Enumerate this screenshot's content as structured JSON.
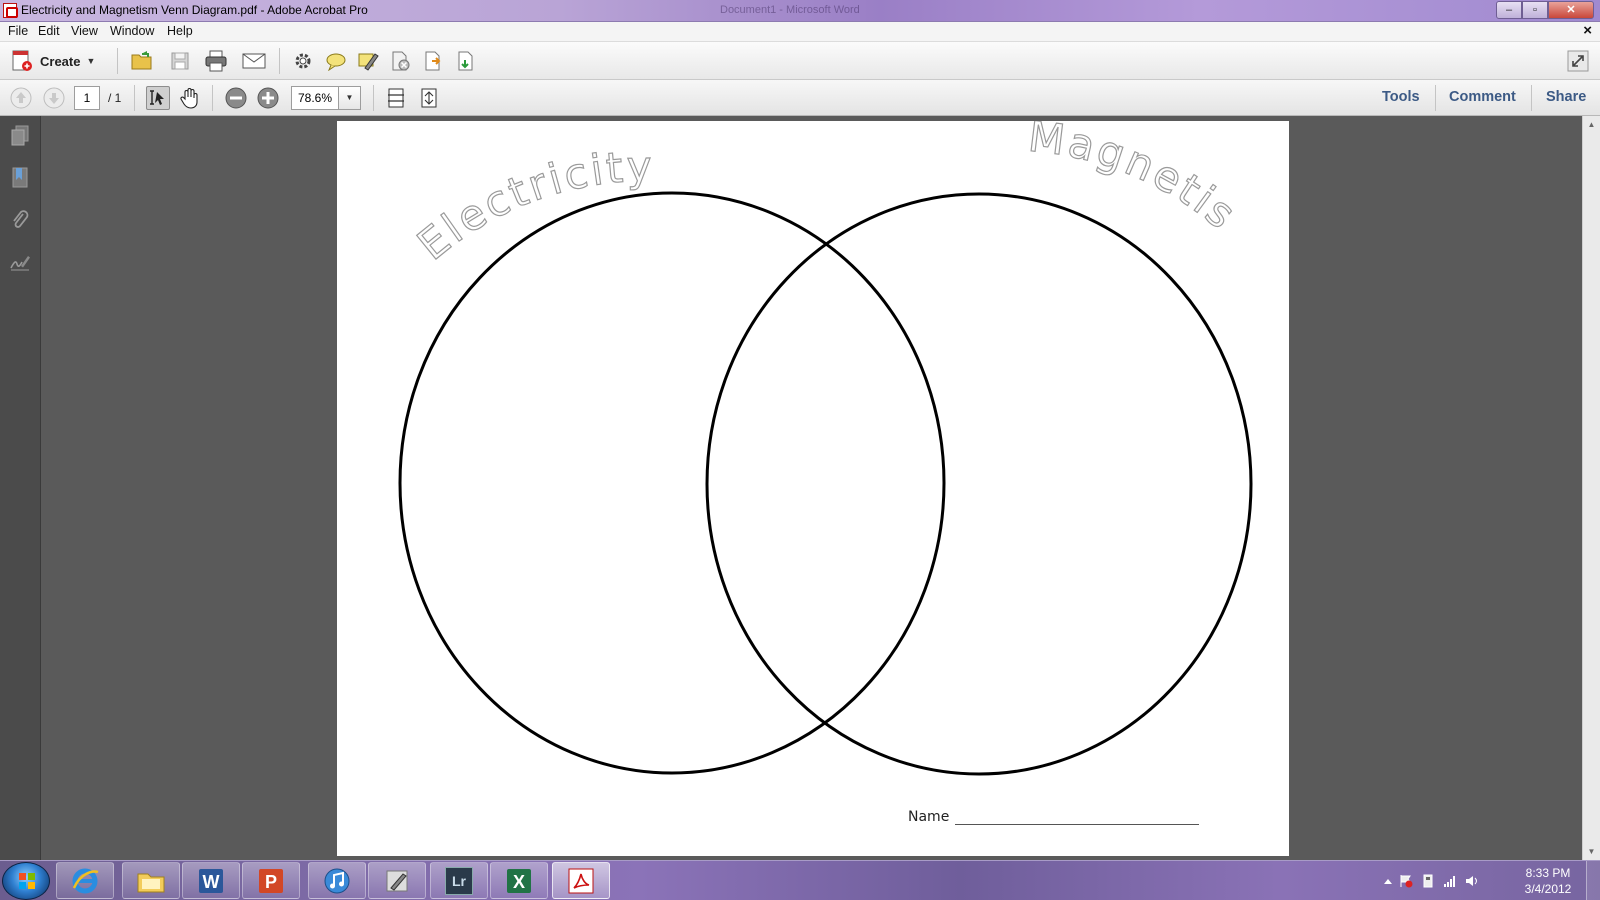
{
  "window": {
    "title": "Electricity and Magnetism Venn Diagram.pdf - Adobe Acrobat Pro",
    "background_title": "Document1 - Microsoft Word",
    "minimize_label": "‒",
    "maximize_label": "▫",
    "close_label": "✕"
  },
  "menu": {
    "items": [
      "File",
      "Edit",
      "View",
      "Window",
      "Help"
    ],
    "doc_close": "×"
  },
  "toolbar": {
    "create_label": "Create",
    "page_current": "1",
    "page_total": "/ 1",
    "zoom": "78.6%",
    "tools_label": "Tools",
    "comment_label": "Comment",
    "share_label": "Share"
  },
  "document": {
    "circle_left_label": "Electricity",
    "circle_right_label": "Magnetism",
    "name_label": "Name"
  },
  "taskbar": {
    "time": "8:33 PM",
    "date": "3/4/2012",
    "apps": [
      "internet-explorer",
      "windows-explorer",
      "word",
      "powerpoint",
      "itunes",
      "pen-app",
      "lightroom",
      "excel",
      "acrobat"
    ],
    "lightroom_label": "Lr"
  },
  "colors": {
    "accent_link": "#3c5a85",
    "pdf_red": "#cc1111",
    "doc_background": "#5a5a5a"
  }
}
